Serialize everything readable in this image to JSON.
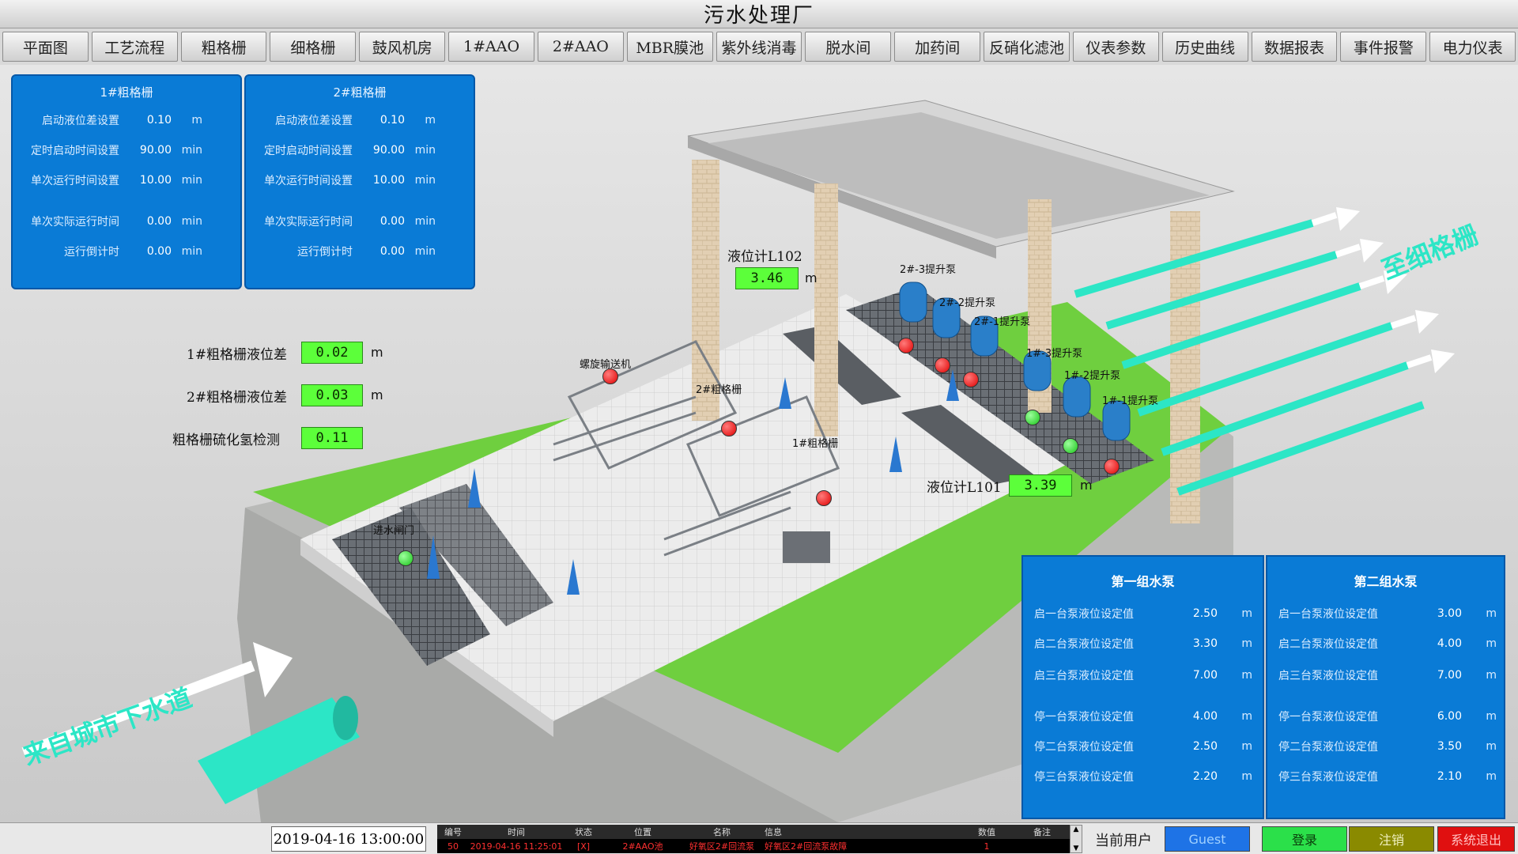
{
  "window_title": "污水处理厂",
  "nav": [
    "平面图",
    "工艺流程",
    "粗格栅",
    "细格栅",
    "鼓风机房",
    "1#AAO",
    "2#AAO",
    "MBR膜池",
    "紫外线消毒",
    "脱水间",
    "加药间",
    "反硝化滤池",
    "仪表参数",
    "历史曲线",
    "数据报表",
    "事件报警",
    "电力仪表"
  ],
  "grid1": {
    "title": "1#粗格栅",
    "rows": [
      {
        "label": "启动液位差设置",
        "value": "0.10",
        "unit": "m"
      },
      {
        "label": "定时启动时间设置",
        "value": "90.00",
        "unit": "min"
      },
      {
        "label": "单次运行时间设置",
        "value": "10.00",
        "unit": "min"
      },
      {
        "label": "单次实际运行时间",
        "value": "0.00",
        "unit": "min"
      },
      {
        "label": "运行倒计时",
        "value": "0.00",
        "unit": "min"
      }
    ]
  },
  "grid2": {
    "title": "2#粗格栅",
    "rows": [
      {
        "label": "启动液位差设置",
        "value": "0.10",
        "unit": "m"
      },
      {
        "label": "定时启动时间设置",
        "value": "90.00",
        "unit": "min"
      },
      {
        "label": "单次运行时间设置",
        "value": "10.00",
        "unit": "min"
      },
      {
        "label": "单次实际运行时间",
        "value": "0.00",
        "unit": "min"
      },
      {
        "label": "运行倒计时",
        "value": "0.00",
        "unit": "min"
      }
    ]
  },
  "measurements": {
    "grid1_level_diff": {
      "label": "1#粗格栅液位差",
      "value": "0.02",
      "unit": "m"
    },
    "grid2_level_diff": {
      "label": "2#粗格栅液位差",
      "value": "0.03",
      "unit": "m"
    },
    "h2s": {
      "label": "粗格栅硫化氢检测",
      "value": "0.11",
      "unit": ""
    },
    "l102": {
      "label": "液位计L102",
      "value": "3.46",
      "unit": "m"
    },
    "l101": {
      "label": "液位计L101",
      "value": "3.39",
      "unit": "m"
    }
  },
  "equipment_labels": {
    "screw_conveyor": "螺旋输送机",
    "grid2": "2#粗格栅",
    "grid1": "1#粗格栅",
    "inlet_gate": "进水闸门",
    "pump_2_3": "2#-3提升泵",
    "pump_2_2": "2#-2提升泵",
    "pump_2_1": "2#-1提升泵",
    "pump_1_3": "1#-3提升泵",
    "pump_1_2": "1#-2提升泵",
    "pump_1_1": "1#-1提升泵"
  },
  "flow_text": {
    "inlet": "来自城市下水道",
    "outlet": "至细格栅"
  },
  "pump_group1": {
    "title": "第一组水泵",
    "rows": [
      {
        "label": "启一台泵液位设定值",
        "value": "2.50",
        "unit": "m"
      },
      {
        "label": "启二台泵液位设定值",
        "value": "3.30",
        "unit": "m"
      },
      {
        "label": "启三台泵液位设定值",
        "value": "7.00",
        "unit": "m"
      },
      {
        "label": "停一台泵液位设定值",
        "value": "4.00",
        "unit": "m"
      },
      {
        "label": "停二台泵液位设定值",
        "value": "2.50",
        "unit": "m"
      },
      {
        "label": "停三台泵液位设定值",
        "value": "2.20",
        "unit": "m"
      }
    ]
  },
  "pump_group2": {
    "title": "第二组水泵",
    "rows": [
      {
        "label": "启一台泵液位设定值",
        "value": "3.00",
        "unit": "m"
      },
      {
        "label": "启二台泵液位设定值",
        "value": "4.00",
        "unit": "m"
      },
      {
        "label": "启三台泵液位设定值",
        "value": "7.00",
        "unit": "m"
      },
      {
        "label": "停一台泵液位设定值",
        "value": "6.00",
        "unit": "m"
      },
      {
        "label": "停二台泵液位设定值",
        "value": "3.50",
        "unit": "m"
      },
      {
        "label": "停三台泵液位设定值",
        "value": "2.10",
        "unit": "m"
      }
    ]
  },
  "status": {
    "datetime": "2019-04-16 13:00:00",
    "event_headers": [
      "编号",
      "时间",
      "状态",
      "位置",
      "名称",
      "信息",
      "数值",
      "备注"
    ],
    "event_row": [
      "50",
      "2019-04-16 11:25:01",
      "[X]",
      "2#AAO池",
      "好氧区2#回流泵",
      "好氧区2#回流泵故障",
      "1",
      ""
    ],
    "current_user_label": "当前用户",
    "user": "Guest",
    "login": "登录",
    "logout": "注销",
    "exit": "系统退出"
  },
  "colors": {
    "panel_blue": "#0a7bd6",
    "value_green": "#5cff3a",
    "alarm_red": "#e00000",
    "run_green": "#18c418",
    "pipe_teal": "#2ce6c6",
    "grass": "#6fcf3f"
  }
}
